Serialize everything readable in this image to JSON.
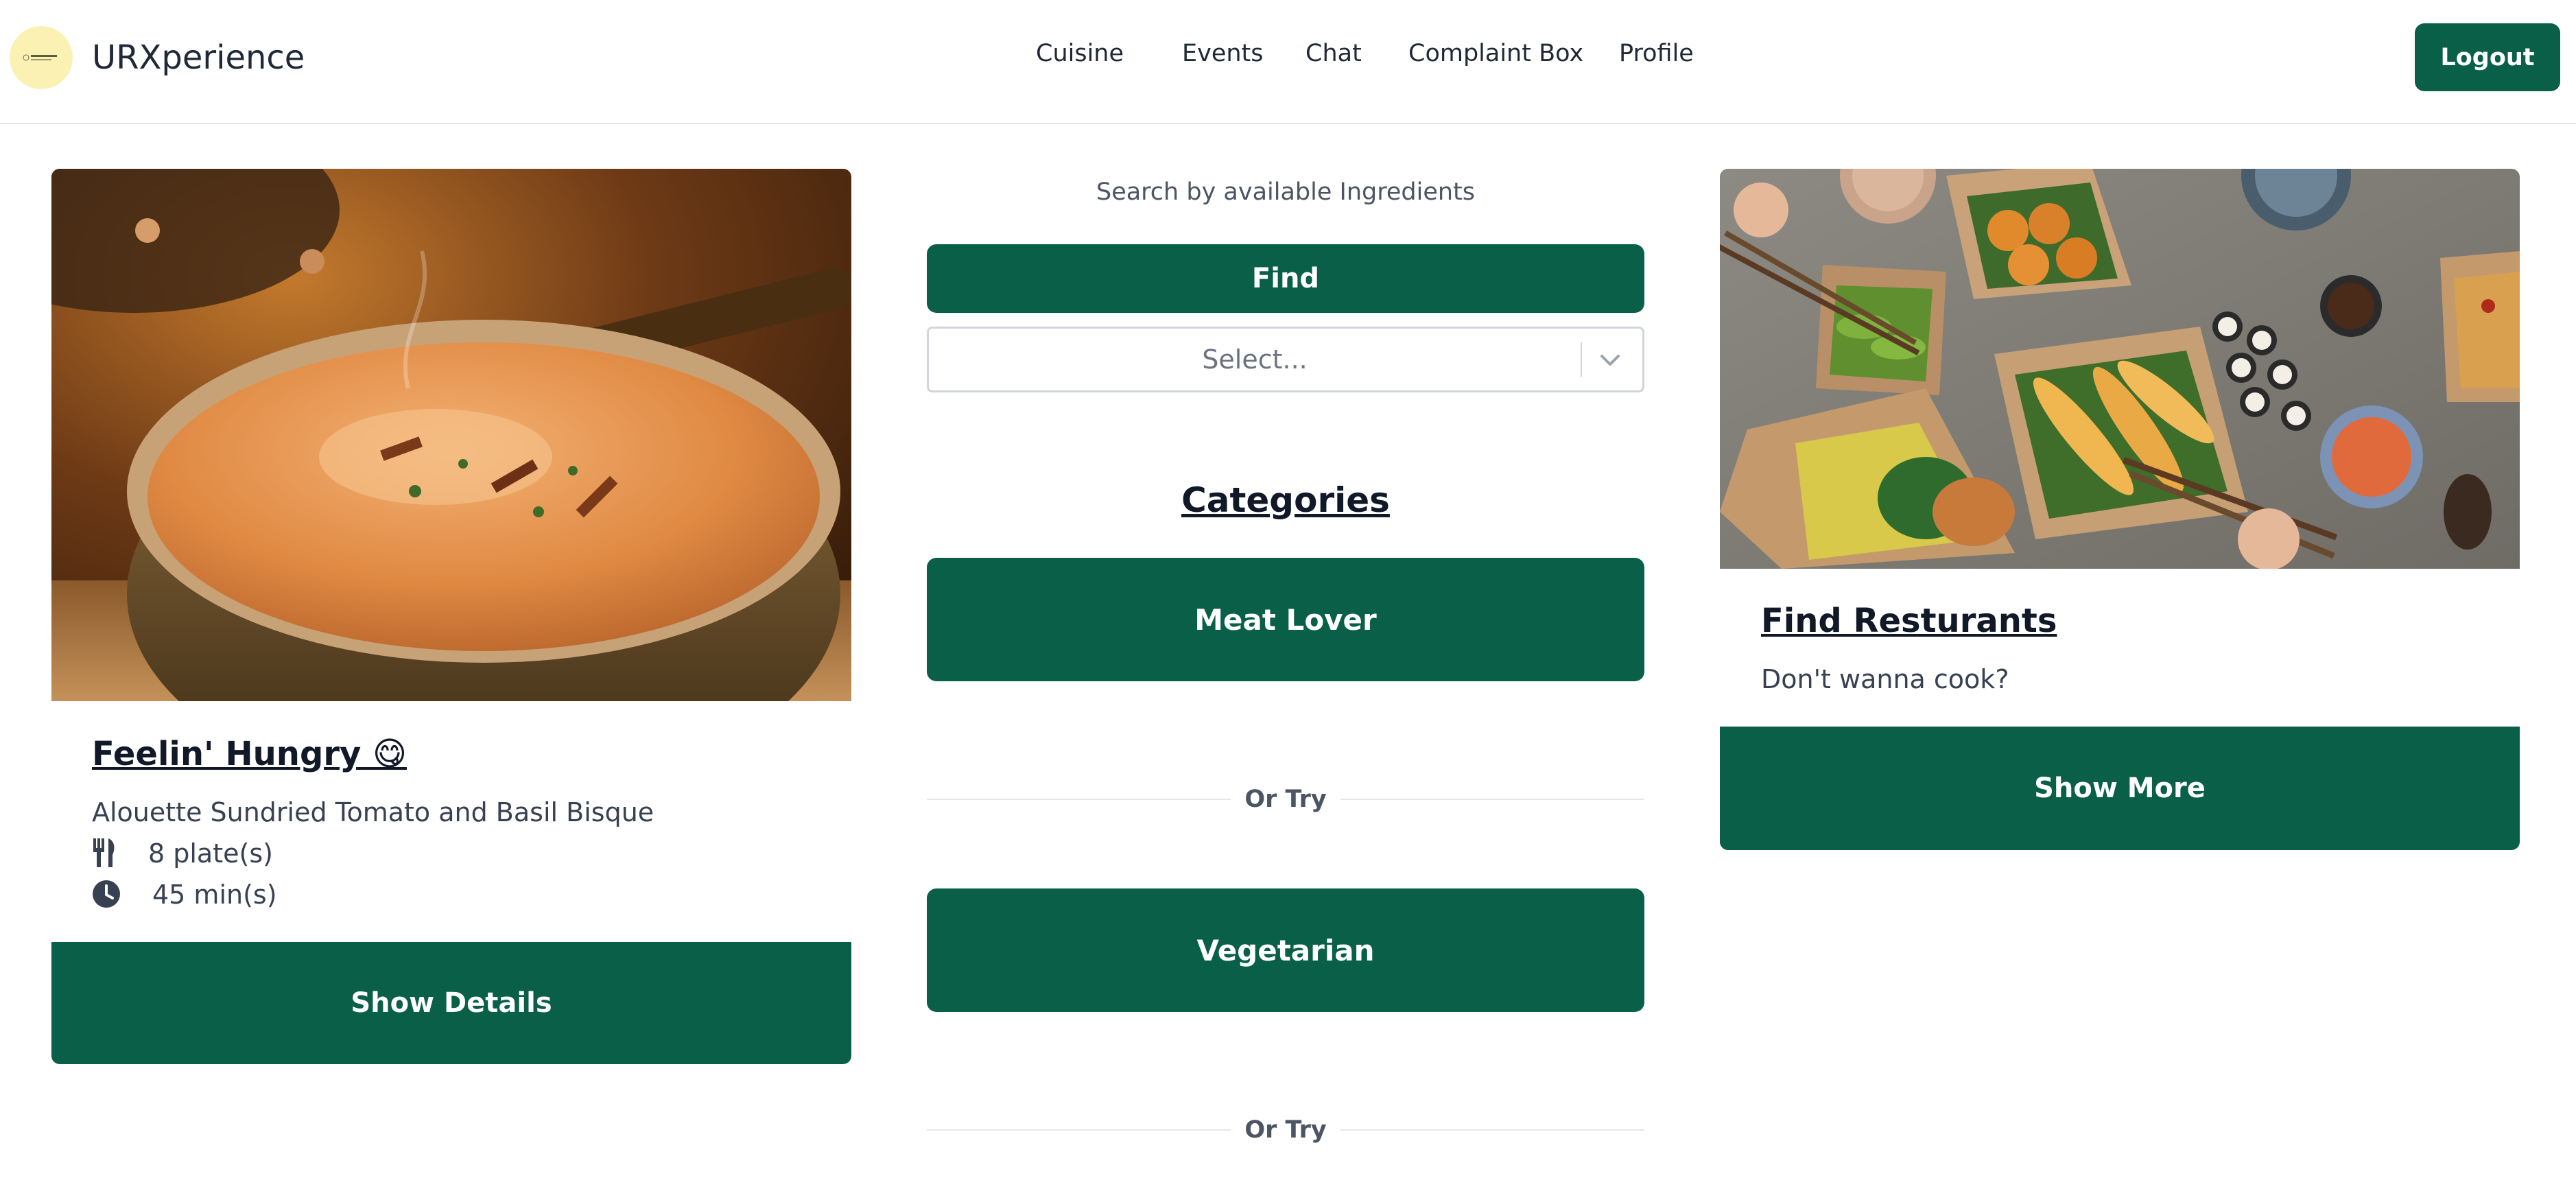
{
  "header": {
    "logo_text": "URXperience",
    "brand": "URXperience",
    "nav": [
      "Cuisine",
      "Events",
      "Chat",
      "Complaint Box",
      "Profile"
    ],
    "logout_label": "Logout"
  },
  "left_card": {
    "title": "Feelin' Hungry 😋",
    "recipe_name": "Alouette Sundried Tomato and Basil Bisque",
    "servings": "8 plate(s)",
    "time": "45 min(s)",
    "button": "Show Details"
  },
  "middle": {
    "search_label": "Search by available Ingredients",
    "find_button": "Find",
    "select_placeholder": "Select...",
    "categories_heading": "Categories",
    "categories": [
      "Meat Lover",
      "Vegetarian"
    ],
    "divider_text": "Or Try"
  },
  "right_card": {
    "title": "Find Resturants",
    "subtitle": "Don't wanna cook?",
    "button": "Show More"
  },
  "colors": {
    "accent": "#0a5f48",
    "logo_bg": "#fbf1b3",
    "text": "#1f2937"
  }
}
